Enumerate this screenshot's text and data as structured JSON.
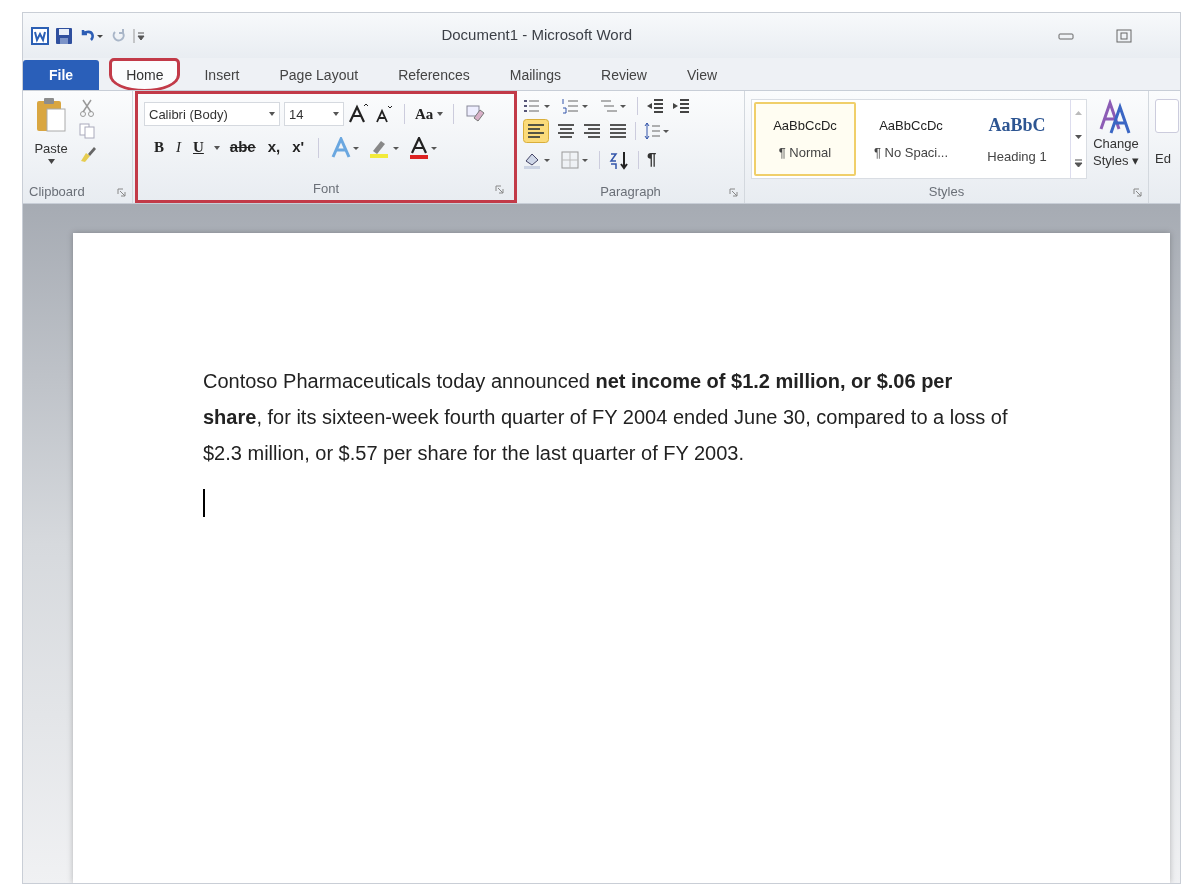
{
  "window": {
    "title": "Document1 - Microsoft Word"
  },
  "tabs": [
    {
      "label": "File",
      "kind": "file",
      "selected": false,
      "circled": false
    },
    {
      "label": "Home",
      "kind": "tab",
      "selected": true,
      "circled": true
    },
    {
      "label": "Insert",
      "kind": "tab",
      "selected": false,
      "circled": false
    },
    {
      "label": "Page Layout",
      "kind": "tab",
      "selected": false,
      "circled": false
    },
    {
      "label": "References",
      "kind": "tab",
      "selected": false,
      "circled": false
    },
    {
      "label": "Mailings",
      "kind": "tab",
      "selected": false,
      "circled": false
    },
    {
      "label": "Review",
      "kind": "tab",
      "selected": false,
      "circled": false
    },
    {
      "label": "View",
      "kind": "tab",
      "selected": false,
      "circled": false
    }
  ],
  "clipboard": {
    "label": "Clipboard",
    "paste_label": "Paste"
  },
  "font": {
    "label": "Font",
    "boxed": true,
    "font_name": "Calibri (Body)",
    "font_size": "14",
    "change_case": "Aa",
    "format_buttons": [
      {
        "label": "B",
        "kind": "bold"
      },
      {
        "label": "I",
        "kind": "italic"
      },
      {
        "label": "U",
        "kind": "underline"
      },
      {
        "label": "abe",
        "kind": "strike"
      },
      {
        "label": "x,",
        "kind": "plain"
      },
      {
        "label": "x'",
        "kind": "plain"
      }
    ]
  },
  "paragraph": {
    "label": "Paragraph",
    "pilcrow": "¶"
  },
  "styles": {
    "label": "Styles",
    "gallery": [
      {
        "preview": "AaBbCcDc",
        "name": "¶ Normal",
        "kind": "body",
        "selected": true
      },
      {
        "preview": "AaBbCcDc",
        "name": "¶ No Spaci...",
        "kind": "body",
        "selected": false
      },
      {
        "preview": "AaBbC",
        "name": "Heading 1",
        "kind": "heading",
        "selected": false
      }
    ],
    "change_styles": [
      "Change",
      "Styles ▾"
    ]
  },
  "editing": {
    "label": "Ed"
  },
  "document": {
    "paragraphs": [
      "Contoso Pharmaceuticals today announced **net income of $1.2 million, or $.06 per share**, for its sixteen-week fourth quarter of FY 2004 ended June 30, compared to a loss of $2.3 million, or $.57 per share for the last quarter of FY 2003."
    ]
  }
}
